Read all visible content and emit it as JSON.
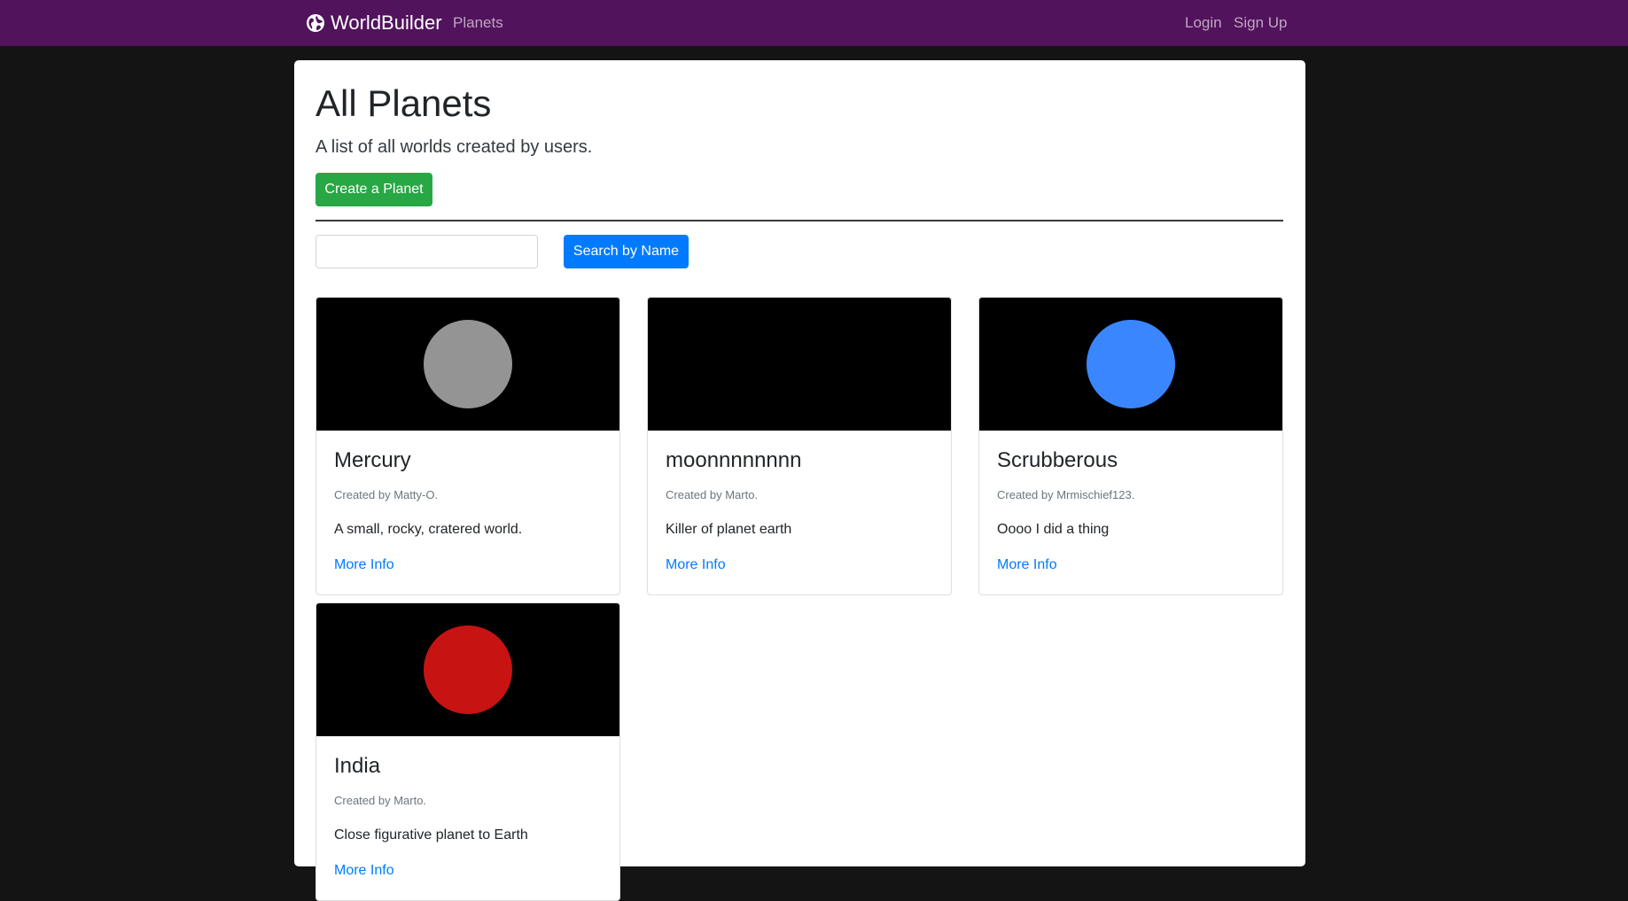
{
  "navbar": {
    "brand": "WorldBuilder",
    "brand_icon": "globe-icon",
    "links": {
      "planets": "Planets",
      "login": "Login",
      "signup": "Sign Up"
    }
  },
  "header": {
    "title": "All Planets",
    "subtitle": "A list of all worlds created by users.",
    "create_button": "Create a Planet"
  },
  "search": {
    "value": "",
    "placeholder": "",
    "button": "Search by Name"
  },
  "planets": [
    {
      "name": "Mercury",
      "author": "Created by Matty-O.",
      "description": "A small, rocky, cratered world.",
      "link": "More Info",
      "color": "#949494"
    },
    {
      "name": "moonnnnnnnn",
      "author": "Created by Marto.",
      "description": "Killer of planet earth",
      "link": "More Info",
      "color": "#000000"
    },
    {
      "name": "Scrubberous",
      "author": "Created by Mrmischief123.",
      "description": "Oooo I did a thing",
      "link": "More Info",
      "color": "#3a86ff"
    },
    {
      "name": "India",
      "author": "Created by Marto.",
      "description": "Close figurative planet to Earth",
      "link": "More Info",
      "color": "#c81313"
    }
  ],
  "colors": {
    "navbar": "#51135c",
    "page_background": "#141414",
    "create_button": "#28a745",
    "search_button": "#007bff",
    "link": "#007bff"
  }
}
